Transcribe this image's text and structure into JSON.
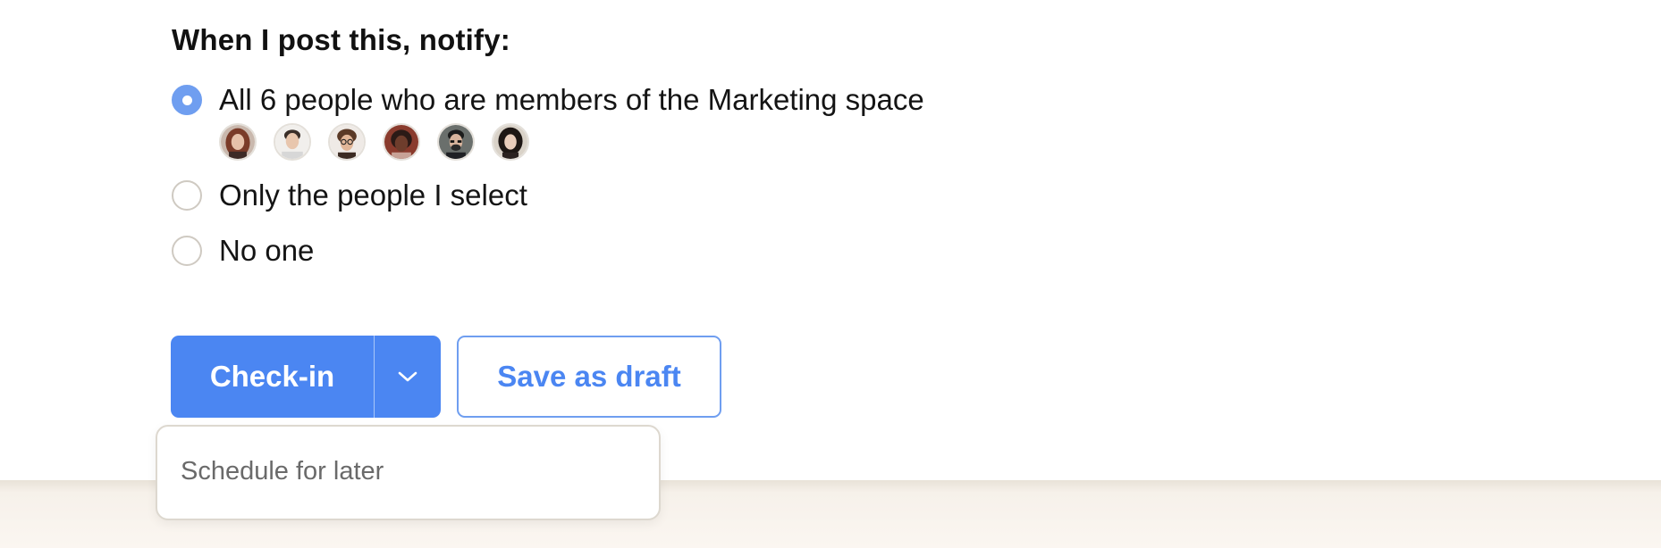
{
  "notify": {
    "heading": "When I post this, notify:",
    "options": [
      {
        "label": "All 6 people who are members of the Marketing space",
        "selected": true
      },
      {
        "label": "Only the people I select",
        "selected": false
      },
      {
        "label": "No one",
        "selected": false
      }
    ],
    "members": [
      {
        "icon": "avatar-woman-red-hair"
      },
      {
        "icon": "avatar-man-light"
      },
      {
        "icon": "avatar-man-glasses-curly"
      },
      {
        "icon": "avatar-woman-dark"
      },
      {
        "icon": "avatar-man-glasses-beard"
      },
      {
        "icon": "avatar-woman-dark-hair"
      }
    ]
  },
  "actions": {
    "checkin_label": "Check-in",
    "caret_icon": "chevron-down-icon",
    "draft_label": "Save as draft",
    "menu": {
      "items": [
        {
          "label": "Schedule for later"
        }
      ]
    }
  },
  "colors": {
    "accent": "#4b86f2",
    "radio_checked": "#6f9ef0",
    "footer_band": "#f6f1ea"
  }
}
